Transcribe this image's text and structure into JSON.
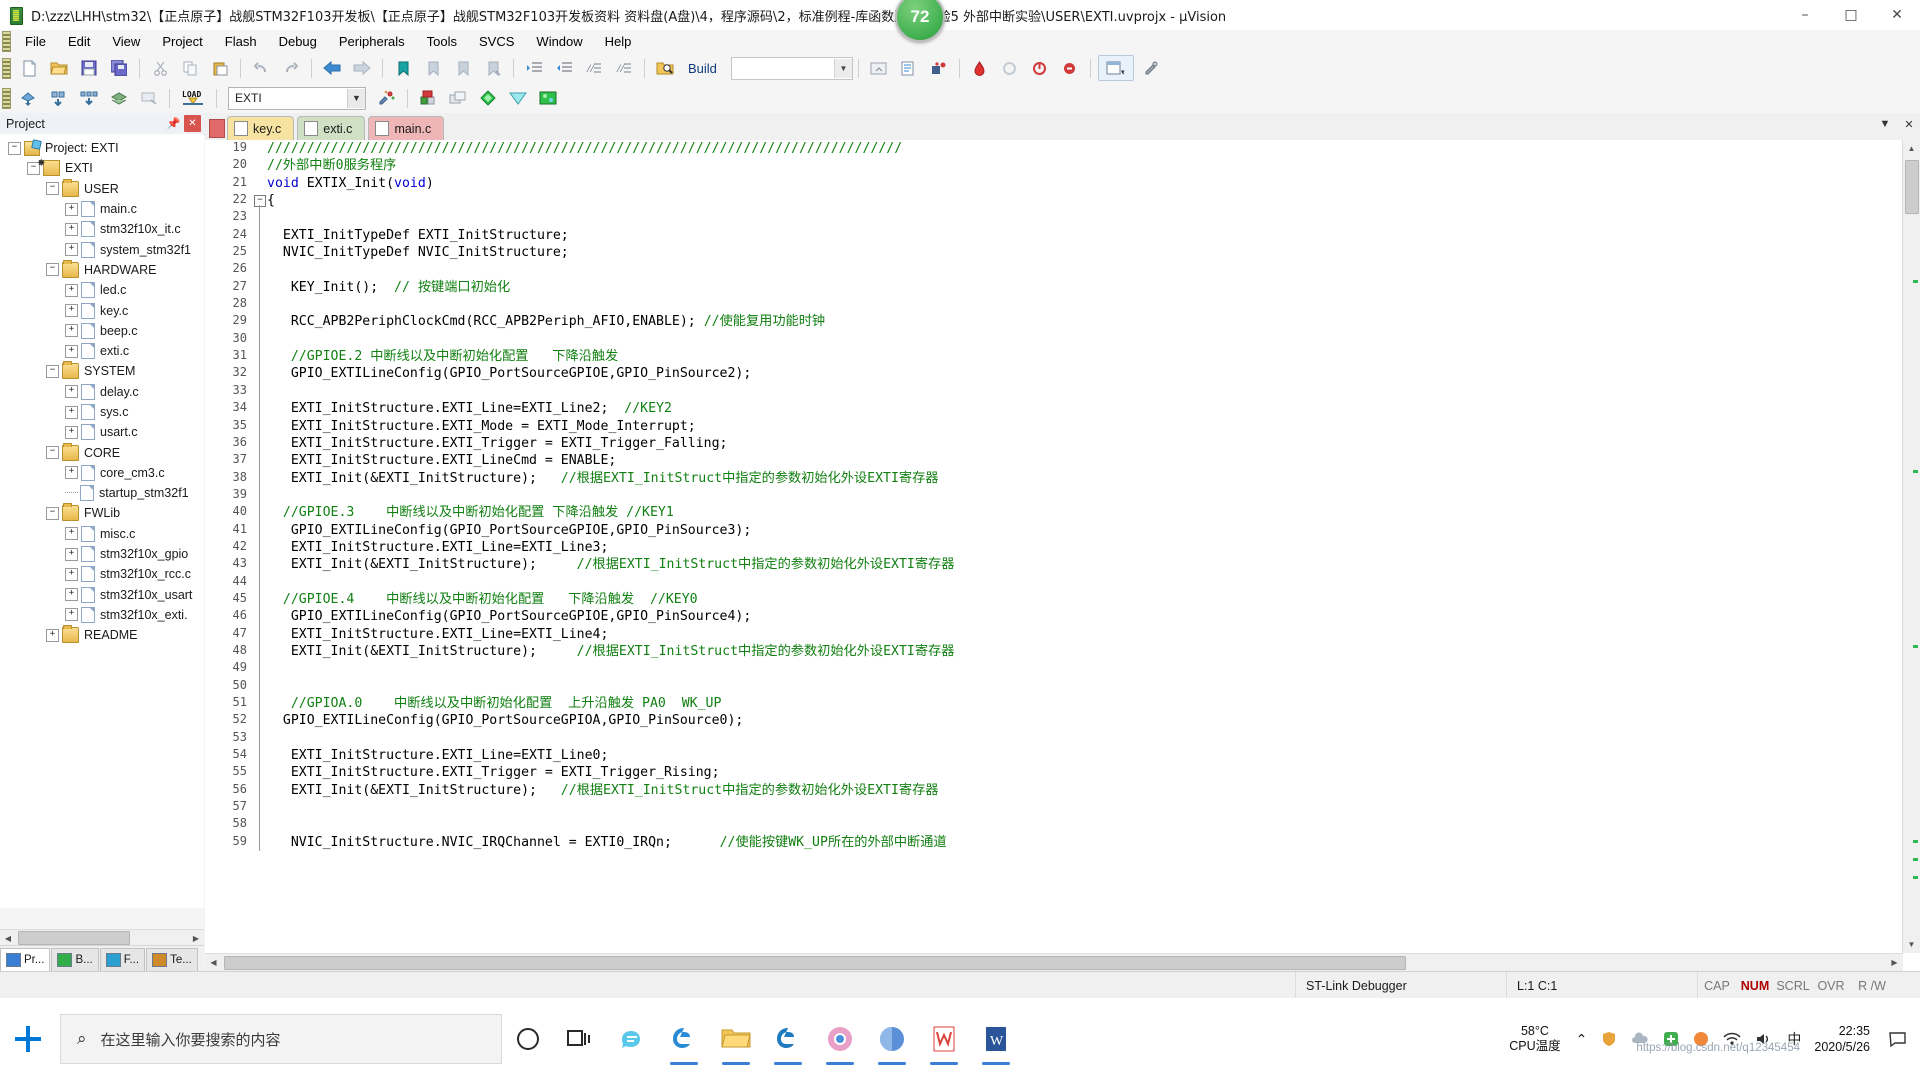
{
  "window": {
    "title": "D:\\zzz\\LHH\\stm32\\【正点原子】战舰STM32F103开发板\\【正点原子】战舰STM32F103开发板资料 资料盘(A盘)\\4，程序源码\\2，标准例程-库函数版本\\实验5 外部中断实验\\USER\\EXTI.uvprojx - µVision",
    "app_icon": "keil-uvision-icon",
    "badge": "72",
    "minimize": "–",
    "maximize": "□",
    "close": "✕"
  },
  "menu": [
    "File",
    "Edit",
    "View",
    "Project",
    "Flash",
    "Debug",
    "Peripherals",
    "Tools",
    "SVCS",
    "Window",
    "Help"
  ],
  "toolbar1": {
    "icons": [
      "new-file-icon",
      "open-file-icon",
      "save-icon",
      "save-all-icon",
      "cut-icon",
      "copy-icon",
      "paste-icon",
      "undo-icon",
      "redo-icon",
      "navigate-back-icon",
      "navigate-forward-icon",
      "bookmark-toggle-icon",
      "bookmark-prev-icon",
      "bookmark-next-icon",
      "bookmark-clear-icon",
      "indent-icon",
      "outdent-icon",
      "comment-icon",
      "uncomment-icon",
      "find-in-files-icon"
    ],
    "build_label": "Build",
    "right_icons": [
      "insert-breakpoint-icon",
      "debug-window-icon",
      "configure-icon"
    ],
    "debug_icons": [
      "start-debug-icon",
      "reset-icon",
      "run-icon",
      "stop-icon",
      "step-icon"
    ],
    "multi_project_icon": "multi-project-window-icon",
    "settings_icon": "configuration-wizard-icon"
  },
  "toolbar2": {
    "icons": [
      "translate-icon",
      "build-target-icon",
      "rebuild-all-icon",
      "batch-build-icon",
      "stop-build-icon"
    ],
    "download_label": "LOAD",
    "target_value": "EXTI",
    "target_dropdown_icon": "chevron-down-icon",
    "right_icons": [
      "options-target-icon",
      "manage-project-items-icon",
      "project-window-icon",
      "books-window-icon",
      "functions-window-icon",
      "templates-window-icon"
    ]
  },
  "project_pane": {
    "title": "Project",
    "pin_icon": "pin-icon",
    "close_icon": "close-icon",
    "tree": [
      {
        "label": "Project: EXTI",
        "depth": 0,
        "expander": "minus",
        "icon": "project-icon"
      },
      {
        "label": "EXTI",
        "depth": 1,
        "expander": "minus",
        "icon": "target-icon"
      },
      {
        "label": "USER",
        "depth": 2,
        "expander": "minus",
        "icon": "folder-icon"
      },
      {
        "label": "main.c",
        "depth": 3,
        "expander": "plus",
        "icon": "c-file-icon"
      },
      {
        "label": "stm32f10x_it.c",
        "depth": 3,
        "expander": "plus",
        "icon": "c-file-icon"
      },
      {
        "label": "system_stm32f1",
        "depth": 3,
        "expander": "plus",
        "icon": "c-file-icon"
      },
      {
        "label": "HARDWARE",
        "depth": 2,
        "expander": "minus",
        "icon": "folder-icon"
      },
      {
        "label": "led.c",
        "depth": 3,
        "expander": "plus",
        "icon": "c-file-icon"
      },
      {
        "label": "key.c",
        "depth": 3,
        "expander": "plus",
        "icon": "c-file-icon"
      },
      {
        "label": "beep.c",
        "depth": 3,
        "expander": "plus",
        "icon": "c-file-icon"
      },
      {
        "label": "exti.c",
        "depth": 3,
        "expander": "plus",
        "icon": "c-file-icon"
      },
      {
        "label": "SYSTEM",
        "depth": 2,
        "expander": "minus",
        "icon": "folder-icon"
      },
      {
        "label": "delay.c",
        "depth": 3,
        "expander": "plus",
        "icon": "c-file-icon"
      },
      {
        "label": "sys.c",
        "depth": 3,
        "expander": "plus",
        "icon": "c-file-icon"
      },
      {
        "label": "usart.c",
        "depth": 3,
        "expander": "plus",
        "icon": "c-file-icon"
      },
      {
        "label": "CORE",
        "depth": 2,
        "expander": "minus",
        "icon": "folder-icon"
      },
      {
        "label": "core_cm3.c",
        "depth": 3,
        "expander": "plus",
        "icon": "c-file-icon"
      },
      {
        "label": "startup_stm32f1",
        "depth": 3,
        "expander": "none",
        "icon": "asm-file-icon"
      },
      {
        "label": "FWLib",
        "depth": 2,
        "expander": "minus",
        "icon": "folder-icon"
      },
      {
        "label": "misc.c",
        "depth": 3,
        "expander": "plus",
        "icon": "c-file-icon"
      },
      {
        "label": "stm32f10x_gpio",
        "depth": 3,
        "expander": "plus",
        "icon": "c-file-icon"
      },
      {
        "label": "stm32f10x_rcc.c",
        "depth": 3,
        "expander": "plus",
        "icon": "c-file-icon"
      },
      {
        "label": "stm32f10x_usart",
        "depth": 3,
        "expander": "plus",
        "icon": "c-file-icon"
      },
      {
        "label": "stm32f10x_exti.",
        "depth": 3,
        "expander": "plus",
        "icon": "c-file-icon"
      },
      {
        "label": "README",
        "depth": 2,
        "expander": "plus",
        "icon": "folder-icon"
      }
    ],
    "bottom_tabs": [
      {
        "label": "Pr...",
        "icon": "project-tab-icon",
        "active": true
      },
      {
        "label": "B...",
        "icon": "books-tab-icon",
        "active": false
      },
      {
        "label": "F...",
        "icon": "functions-tab-icon",
        "active": false
      },
      {
        "label": "Te...",
        "icon": "templates-tab-icon",
        "active": false
      }
    ]
  },
  "editor": {
    "tabs": [
      {
        "label": "key.c",
        "color_class": "t-key",
        "active": false
      },
      {
        "label": "exti.c",
        "color_class": "t-exti",
        "active": true
      },
      {
        "label": "main.c",
        "color_class": "t-main",
        "active": false
      }
    ],
    "tab_controls": [
      "chevron-down-icon",
      "close-icon"
    ],
    "first_line_number": 19,
    "lines": [
      {
        "n": 19,
        "text": "////////////////////////////////////////////////////////////////////////////////",
        "cls": "cm"
      },
      {
        "n": 20,
        "text": "//外部中断0服务程序",
        "cls": "cm"
      },
      {
        "n": 21,
        "text": "void EXTIX_Init(void)",
        "cls": "code-sig"
      },
      {
        "n": 22,
        "text": "{",
        "cls": "plain",
        "fold": true
      },
      {
        "n": 23,
        "text": "",
        "cls": "plain"
      },
      {
        "n": 24,
        "text": "  EXTI_InitTypeDef EXTI_InitStructure;",
        "cls": "plain"
      },
      {
        "n": 25,
        "text": "  NVIC_InitTypeDef NVIC_InitStructure;",
        "cls": "plain"
      },
      {
        "n": 26,
        "text": "",
        "cls": "plain"
      },
      {
        "n": 27,
        "text": "   KEY_Init();  // 按键端口初始化",
        "cls": "mixed"
      },
      {
        "n": 28,
        "text": "",
        "cls": "plain"
      },
      {
        "n": 29,
        "text": "   RCC_APB2PeriphClockCmd(RCC_APB2Periph_AFIO,ENABLE); //使能复用功能时钟",
        "cls": "mixed"
      },
      {
        "n": 30,
        "text": "",
        "cls": "plain"
      },
      {
        "n": 31,
        "text": "   //GPIOE.2 中断线以及中断初始化配置   下降沿触发",
        "cls": "cm"
      },
      {
        "n": 32,
        "text": "   GPIO_EXTILineConfig(GPIO_PortSourceGPIOE,GPIO_PinSource2);",
        "cls": "plain"
      },
      {
        "n": 33,
        "text": "",
        "cls": "plain"
      },
      {
        "n": 34,
        "text": "   EXTI_InitStructure.EXTI_Line=EXTI_Line2;  //KEY2",
        "cls": "mixed"
      },
      {
        "n": 35,
        "text": "   EXTI_InitStructure.EXTI_Mode = EXTI_Mode_Interrupt;",
        "cls": "plain"
      },
      {
        "n": 36,
        "text": "   EXTI_InitStructure.EXTI_Trigger = EXTI_Trigger_Falling;",
        "cls": "plain"
      },
      {
        "n": 37,
        "text": "   EXTI_InitStructure.EXTI_LineCmd = ENABLE;",
        "cls": "plain"
      },
      {
        "n": 38,
        "text": "   EXTI_Init(&EXTI_InitStructure);   //根据EXTI_InitStruct中指定的参数初始化外设EXTI寄存器",
        "cls": "mixed"
      },
      {
        "n": 39,
        "text": "",
        "cls": "plain"
      },
      {
        "n": 40,
        "text": "  //GPIOE.3    中断线以及中断初始化配置 下降沿触发 //KEY1",
        "cls": "cm"
      },
      {
        "n": 41,
        "text": "   GPIO_EXTILineConfig(GPIO_PortSourceGPIOE,GPIO_PinSource3);",
        "cls": "plain"
      },
      {
        "n": 42,
        "text": "   EXTI_InitStructure.EXTI_Line=EXTI_Line3;",
        "cls": "plain"
      },
      {
        "n": 43,
        "text": "   EXTI_Init(&EXTI_InitStructure);     //根据EXTI_InitStruct中指定的参数初始化外设EXTI寄存器",
        "cls": "mixed"
      },
      {
        "n": 44,
        "text": "",
        "cls": "plain"
      },
      {
        "n": 45,
        "text": "  //GPIOE.4    中断线以及中断初始化配置   下降沿触发  //KEY0",
        "cls": "cm"
      },
      {
        "n": 46,
        "text": "   GPIO_EXTILineConfig(GPIO_PortSourceGPIOE,GPIO_PinSource4);",
        "cls": "plain"
      },
      {
        "n": 47,
        "text": "   EXTI_InitStructure.EXTI_Line=EXTI_Line4;",
        "cls": "plain"
      },
      {
        "n": 48,
        "text": "   EXTI_Init(&EXTI_InitStructure);     //根据EXTI_InitStruct中指定的参数初始化外设EXTI寄存器",
        "cls": "mixed"
      },
      {
        "n": 49,
        "text": "",
        "cls": "plain"
      },
      {
        "n": 50,
        "text": "",
        "cls": "plain"
      },
      {
        "n": 51,
        "text": "   //GPIOA.0    中断线以及中断初始化配置  上升沿触发 PA0  WK_UP",
        "cls": "cm"
      },
      {
        "n": 52,
        "text": "  GPIO_EXTILineConfig(GPIO_PortSourceGPIOA,GPIO_PinSource0);",
        "cls": "plain"
      },
      {
        "n": 53,
        "text": "",
        "cls": "plain"
      },
      {
        "n": 54,
        "text": "   EXTI_InitStructure.EXTI_Line=EXTI_Line0;",
        "cls": "plain"
      },
      {
        "n": 55,
        "text": "   EXTI_InitStructure.EXTI_Trigger = EXTI_Trigger_Rising;",
        "cls": "plain"
      },
      {
        "n": 56,
        "text": "   EXTI_Init(&EXTI_InitStructure);   //根据EXTI_InitStruct中指定的参数初始化外设EXTI寄存器",
        "cls": "mixed"
      },
      {
        "n": 57,
        "text": "",
        "cls": "plain"
      },
      {
        "n": 58,
        "text": "",
        "cls": "plain"
      },
      {
        "n": 59,
        "text": "   NVIC_InitStructure.NVIC_IRQChannel = EXTI0_IRQn;      //使能按键WK_UP所在的外部中断通道",
        "cls": "mixed"
      }
    ]
  },
  "statusbar": {
    "debugger": "ST-Link Debugger",
    "position": "L:1 C:1",
    "flags": [
      "CAP",
      "NUM",
      "SCRL",
      "OVR",
      "R /W"
    ],
    "num_active": true
  },
  "taskbar": {
    "start_icon": "windows-start-icon",
    "search_placeholder": "在这里输入你要搜索的内容",
    "search_icon": "search-icon",
    "items": [
      {
        "icon": "cortana-circle-icon",
        "running": false
      },
      {
        "icon": "task-view-icon",
        "running": false
      },
      {
        "icon": "sogou-input-icon",
        "running": false
      },
      {
        "icon": "edge-legacy-icon",
        "running": true
      },
      {
        "icon": "file-explorer-icon",
        "running": true
      },
      {
        "icon": "edge-chromium-icon",
        "running": true
      },
      {
        "icon": "chrome-like-icon",
        "running": true
      },
      {
        "icon": "browser-blue-icon",
        "running": true
      },
      {
        "icon": "wps-icon",
        "running": true
      },
      {
        "icon": "word-icon",
        "running": true
      }
    ],
    "tray": {
      "cpu_temp_value": "58°C",
      "cpu_temp_label": "CPU温度",
      "chevron_icon": "chevron-up-icon",
      "icons": [
        "shield-icon",
        "cloud-icon",
        "green-plus-icon",
        "orange-icon",
        "network-icon",
        "speaker-icon"
      ],
      "ime": "中",
      "time": "22:35",
      "date": "2020/5/26",
      "notification_icon": "notifications-icon"
    }
  },
  "watermark": "https://blog.csdn.net/q12345454"
}
